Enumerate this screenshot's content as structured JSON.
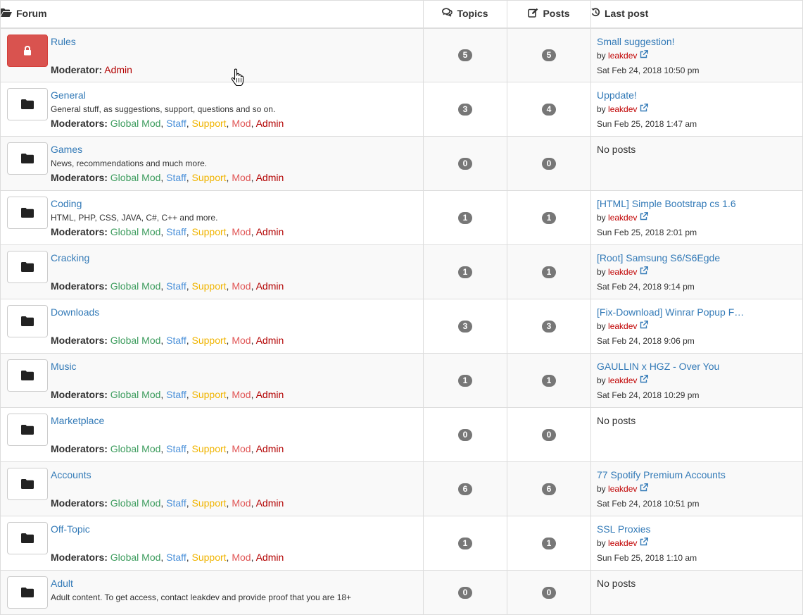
{
  "header": {
    "forum": "Forum",
    "topics": "Topics",
    "posts": "Posts",
    "last_post": "Last post"
  },
  "colors": {
    "link": "#337ab7",
    "locked_icon_bg": "#d9534f",
    "badge": "#777777",
    "username": "#c00000",
    "global_mod": "#3c9c5d",
    "staff": "#4a90d9",
    "support": "#f0b400",
    "mod": "#e05555",
    "admin": "#b20000"
  },
  "labels": {
    "moderator_single": "Moderator:",
    "moderators": "Moderators:",
    "by": "by",
    "no_posts": "No posts"
  },
  "groups": {
    "global_mod": "Global Mod",
    "staff": "Staff",
    "support": "Support",
    "mod": "Mod",
    "admin": "Admin"
  },
  "forums": [
    {
      "title": "Rules",
      "description": "",
      "icon": "lock-icon",
      "moderators": "single-admin",
      "topics": "5",
      "posts": "5",
      "last": {
        "title": "Small suggestion!",
        "user": "leakdev",
        "date": "Sat Feb 24, 2018 10:50 pm"
      }
    },
    {
      "title": "General",
      "description": "General stuff, as suggestions, support, questions and so on.",
      "icon": "folder-icon",
      "moderators": "all",
      "topics": "3",
      "posts": "4",
      "last": {
        "title": "Uppdate!",
        "user": "leakdev",
        "date": "Sun Feb 25, 2018 1:47 am"
      }
    },
    {
      "title": "Games",
      "description": "News, recommendations and much more.",
      "icon": "folder-icon",
      "moderators": "all",
      "topics": "0",
      "posts": "0",
      "last": null
    },
    {
      "title": "Coding",
      "description": "HTML, PHP, CSS, JAVA, C#, C++ and more.",
      "icon": "folder-icon",
      "moderators": "all",
      "topics": "1",
      "posts": "1",
      "last": {
        "title": "[HTML] Simple Bootstrap cs 1.6",
        "user": "leakdev",
        "date": "Sun Feb 25, 2018 2:01 pm"
      }
    },
    {
      "title": "Cracking",
      "description": "",
      "icon": "folder-icon",
      "moderators": "all",
      "topics": "1",
      "posts": "1",
      "last": {
        "title": "[Root] Samsung S6/S6Egde",
        "user": "leakdev",
        "date": "Sat Feb 24, 2018 9:14 pm"
      }
    },
    {
      "title": "Downloads",
      "description": "",
      "icon": "folder-icon",
      "moderators": "all",
      "topics": "3",
      "posts": "3",
      "last": {
        "title": "[Fix-Download] Winrar Popup F…",
        "user": "leakdev",
        "date": "Sat Feb 24, 2018 9:06 pm"
      }
    },
    {
      "title": "Music",
      "description": "",
      "icon": "folder-icon",
      "moderators": "all",
      "topics": "1",
      "posts": "1",
      "last": {
        "title": "GAULLIN x HGZ - Over You",
        "user": "leakdev",
        "date": "Sat Feb 24, 2018 10:29 pm"
      }
    },
    {
      "title": "Marketplace",
      "description": "",
      "icon": "folder-icon",
      "moderators": "all",
      "topics": "0",
      "posts": "0",
      "last": null
    },
    {
      "title": "Accounts",
      "description": "",
      "icon": "folder-icon",
      "moderators": "all",
      "topics": "6",
      "posts": "6",
      "last": {
        "title": "77 Spotify Premium Accounts",
        "user": "leakdev",
        "date": "Sat Feb 24, 2018 10:51 pm"
      }
    },
    {
      "title": "Off-Topic",
      "description": "",
      "icon": "folder-icon",
      "moderators": "all",
      "topics": "1",
      "posts": "1",
      "last": {
        "title": "SSL Proxies",
        "user": "leakdev",
        "date": "Sun Feb 25, 2018 1:10 am"
      }
    },
    {
      "title": "Adult",
      "description": "Adult content. To get access, contact leakdev and provide proof that you are 18+",
      "icon": "folder-icon",
      "moderators": "none",
      "topics": "0",
      "posts": "0",
      "last": null
    }
  ]
}
